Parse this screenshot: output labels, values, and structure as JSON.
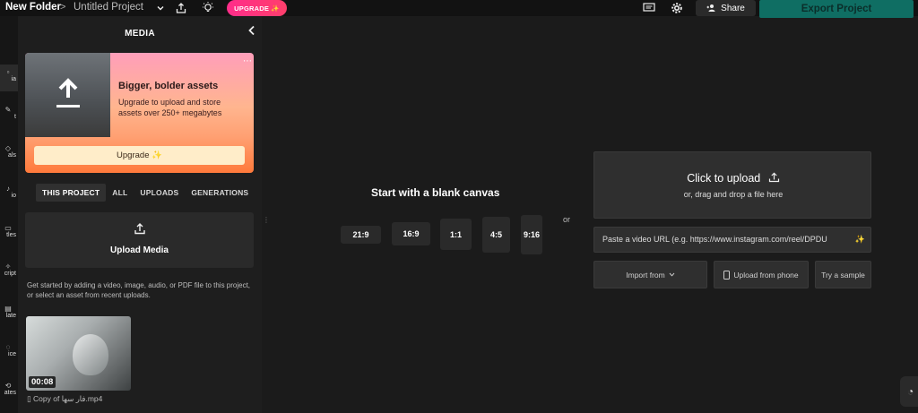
{
  "header": {
    "folder": "New Folder",
    "separator": ">",
    "project": "Untitled Project",
    "chevron": "⌄",
    "upgrade": "UPGRADE ✨",
    "share": "Share",
    "export": "Export Project"
  },
  "rail": {
    "items": [
      {
        "label": "ia",
        "icon": "▫"
      },
      {
        "label": "t",
        "icon": "✎"
      },
      {
        "label": "als",
        "icon": "◇"
      },
      {
        "label": "io",
        "icon": "♪"
      },
      {
        "label": "tles",
        "icon": "▭"
      },
      {
        "label": "cript",
        "icon": "✧"
      },
      {
        "label": "late",
        "icon": "▤"
      },
      {
        "label": "ice",
        "icon": "◌"
      },
      {
        "label": "ates",
        "icon": "⟲"
      }
    ]
  },
  "panel": {
    "title": "MEDIA",
    "collapse": "‹",
    "promo": {
      "heading": "Bigger, bolder assets",
      "body": "Upgrade to upload and store assets over 250+ megabytes",
      "button": "Upgrade ✨",
      "menu": "⋯"
    },
    "tabs": [
      "THIS PROJECT",
      "ALL",
      "UPLOADS",
      "GENERATIONS"
    ],
    "upload_media": "Upload Media",
    "help": "Get started by adding a video, image, audio, or PDF file to this project, or select an asset from recent uploads.",
    "asset": {
      "duration": "00:08",
      "name": "Copy of فار سها.mp4"
    }
  },
  "canvas": {
    "title": "Start with a blank canvas",
    "ratios": [
      "21:9",
      "16:9",
      "1:1",
      "4:5",
      "9:16"
    ],
    "or": "or"
  },
  "upload": {
    "click": "Click to upload",
    "drag": "or, drag and drop a file here",
    "url_placeholder": "Paste a video URL (e.g. https://www.instagram.com/reel/DPDU",
    "import": "Import from",
    "phone": "Upload from phone",
    "sample": "Try a sample"
  },
  "colors": {
    "accent": "#ff2d8a",
    "export": "#0f6e63",
    "background": "#1b1b1b"
  }
}
